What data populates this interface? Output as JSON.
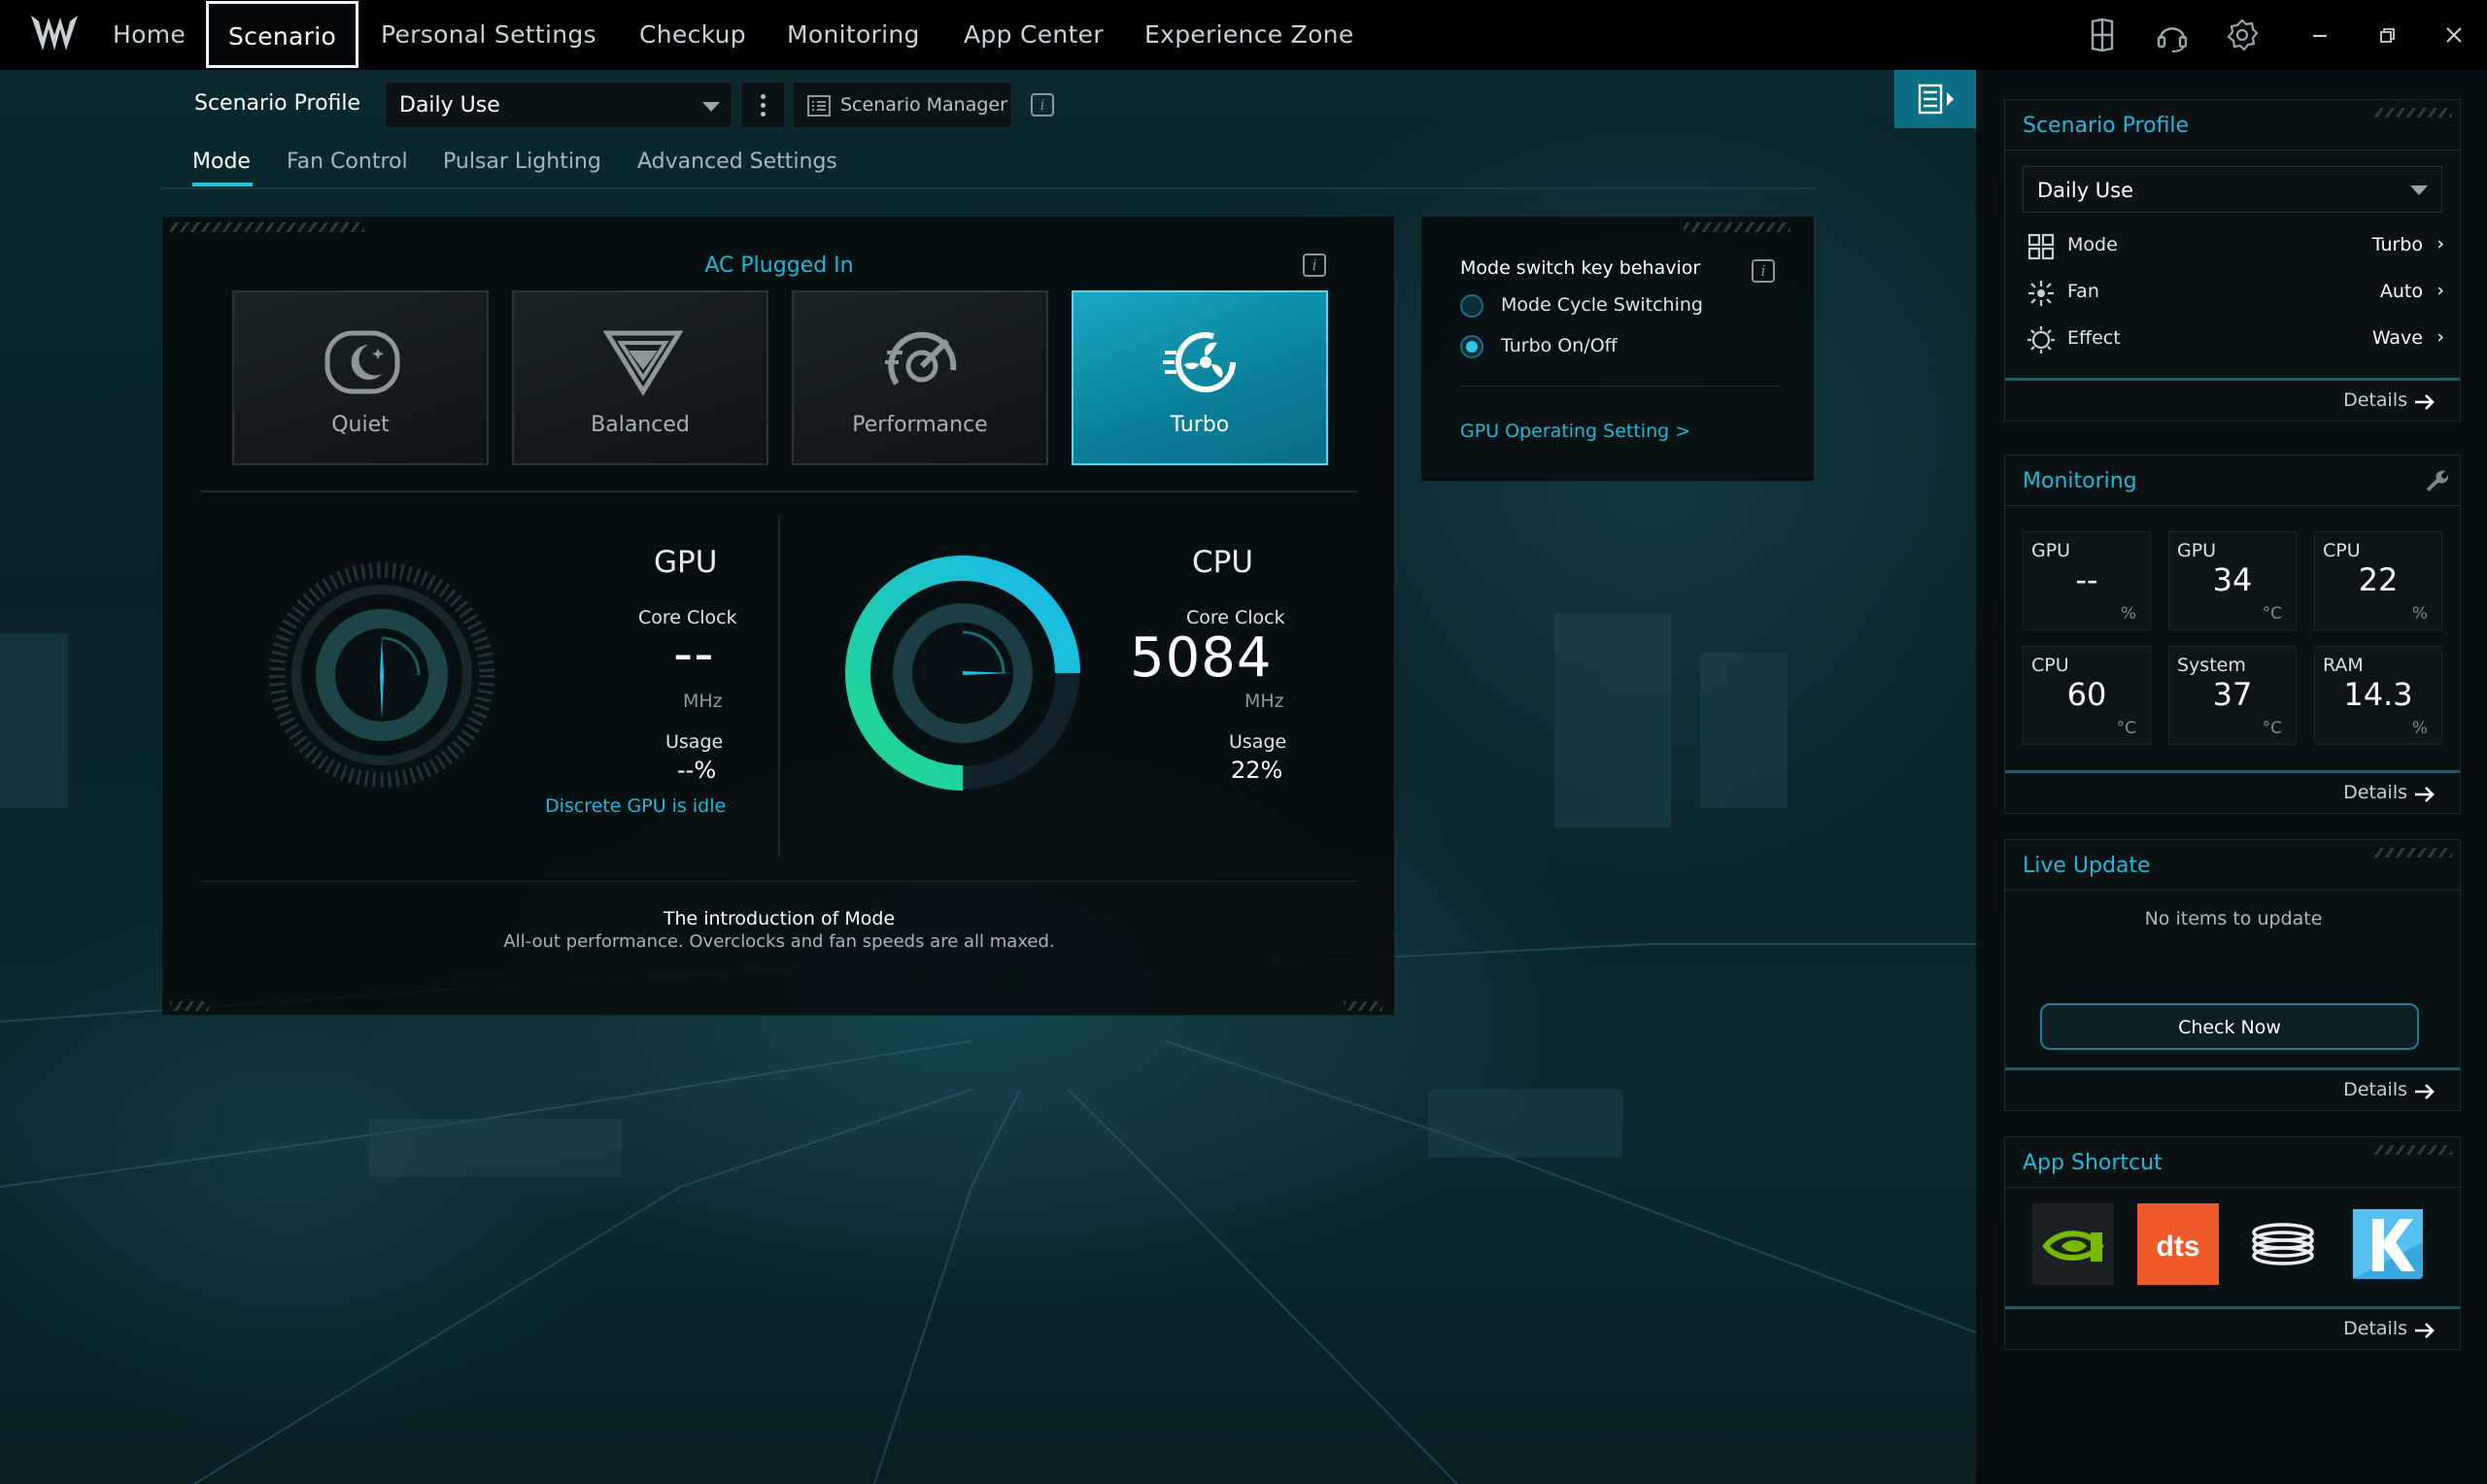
{
  "nav": {
    "items": [
      "Home",
      "Scenario",
      "Personal Settings",
      "Checkup",
      "Monitoring",
      "App Center",
      "Experience Zone"
    ],
    "active": "Scenario"
  },
  "profile": {
    "label": "Scenario Profile",
    "selected": "Daily Use",
    "manager_label": "Scenario Manager"
  },
  "subtabs": [
    "Mode",
    "Fan Control",
    "Pulsar Lighting",
    "Advanced Settings"
  ],
  "mode": {
    "power_state": "AC Plugged In",
    "modes": [
      {
        "label": "Quiet",
        "active": false
      },
      {
        "label": "Balanced",
        "active": false
      },
      {
        "label": "Performance",
        "active": false
      },
      {
        "label": "Turbo",
        "active": true
      }
    ],
    "gpu": {
      "title": "GPU",
      "clock_label": "Core Clock",
      "clock_value": "--",
      "clock_unit": "MHz",
      "usage_label": "Usage",
      "usage_value": "--%",
      "idle_link": "Discrete GPU is idle"
    },
    "cpu": {
      "title": "CPU",
      "clock_label": "Core Clock",
      "clock_value": "5084",
      "clock_unit": "MHz",
      "usage_label": "Usage",
      "usage_value": "22%",
      "usage_fraction": 0.22
    },
    "intro_title": "The introduction of Mode",
    "intro_text": "All-out performance. Overclocks and fan speeds are all maxed."
  },
  "switch_behavior": {
    "title": "Mode switch key behavior",
    "options": [
      {
        "label": "Mode Cycle Switching",
        "selected": false
      },
      {
        "label": "Turbo On/Off",
        "selected": true
      }
    ],
    "gpu_link": "GPU Operating Setting >"
  },
  "sidebar": {
    "details_label": "Details",
    "scenario": {
      "title": "Scenario Profile",
      "selected": "Daily Use",
      "rows": [
        {
          "key": "Mode",
          "value": "Turbo",
          "icon": "grid-icon"
        },
        {
          "key": "Fan",
          "value": "Auto",
          "icon": "fan-icon"
        },
        {
          "key": "Effect",
          "value": "Wave",
          "icon": "sun-icon"
        }
      ]
    },
    "monitoring": {
      "title": "Monitoring",
      "tiles": [
        {
          "name": "GPU",
          "value": "--",
          "unit": "%"
        },
        {
          "name": "GPU",
          "value": "34",
          "unit": "°C"
        },
        {
          "name": "CPU",
          "value": "22",
          "unit": "%"
        },
        {
          "name": "CPU",
          "value": "60",
          "unit": "°C"
        },
        {
          "name": "System",
          "value": "37",
          "unit": "°C"
        },
        {
          "name": "RAM",
          "value": "14.3",
          "unit": "%"
        }
      ]
    },
    "live_update": {
      "title": "Live Update",
      "status": "No items to update",
      "button": "Check Now"
    },
    "app_shortcut": {
      "title": "App Shortcut",
      "apps": [
        {
          "name": "NVIDIA",
          "icon": "nvidia-icon"
        },
        {
          "name": "dts",
          "icon": "dts-icon"
        },
        {
          "name": "Coil",
          "icon": "coil-icon"
        },
        {
          "name": "K",
          "icon": "k-icon"
        }
      ]
    }
  },
  "colors": {
    "accent": "#21c4e0",
    "turbo_card": "#0a7f99",
    "topbar": "#000000"
  }
}
